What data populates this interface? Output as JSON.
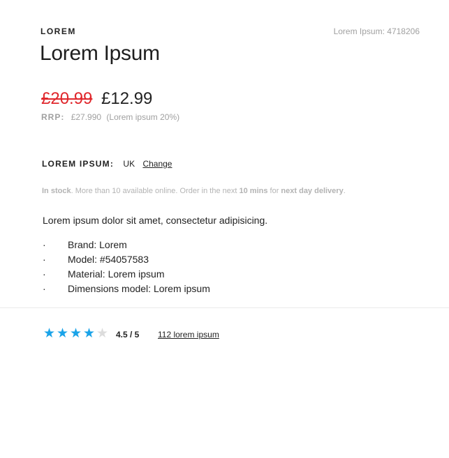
{
  "product": {
    "brand": "LOREM",
    "sku": "Lorem Ipsum: 4718206",
    "title": "Lorem Ipsum"
  },
  "price": {
    "old": "£20.99",
    "current": "£12.99",
    "rrp_label": "RRP:",
    "rrp_value": "£27.990",
    "rrp_note": "(Lorem ipsum 20%)"
  },
  "shipping": {
    "label": "LOREM IPSUM:",
    "country": "UK",
    "change_label": "Change"
  },
  "stock": {
    "in_stock": "In stock",
    "text1": ". More than 10 available online. Order in the next ",
    "time": "10 mins",
    "text2": " for ",
    "delivery": "next day delivery",
    "text3": "."
  },
  "description": "Lorem ipsum dolor sit amet, consectetur adipisicing.",
  "features": {
    "bullet": "·",
    "items": [
      "Brand: Lorem",
      "Model: #54057583",
      "Material: Lorem ipsum",
      "Dimensions model: Lorem ipsum"
    ]
  },
  "rating": {
    "value": 4.5,
    "max": 5,
    "filled_stars": 4,
    "total_stars": 5,
    "star_color": "#1aa3e8",
    "score_text": "4.5 / 5",
    "reviews_link": "112 lorem ipsum"
  },
  "colors": {
    "sale_price": "#e0282d",
    "muted": "#a0a0a0"
  }
}
